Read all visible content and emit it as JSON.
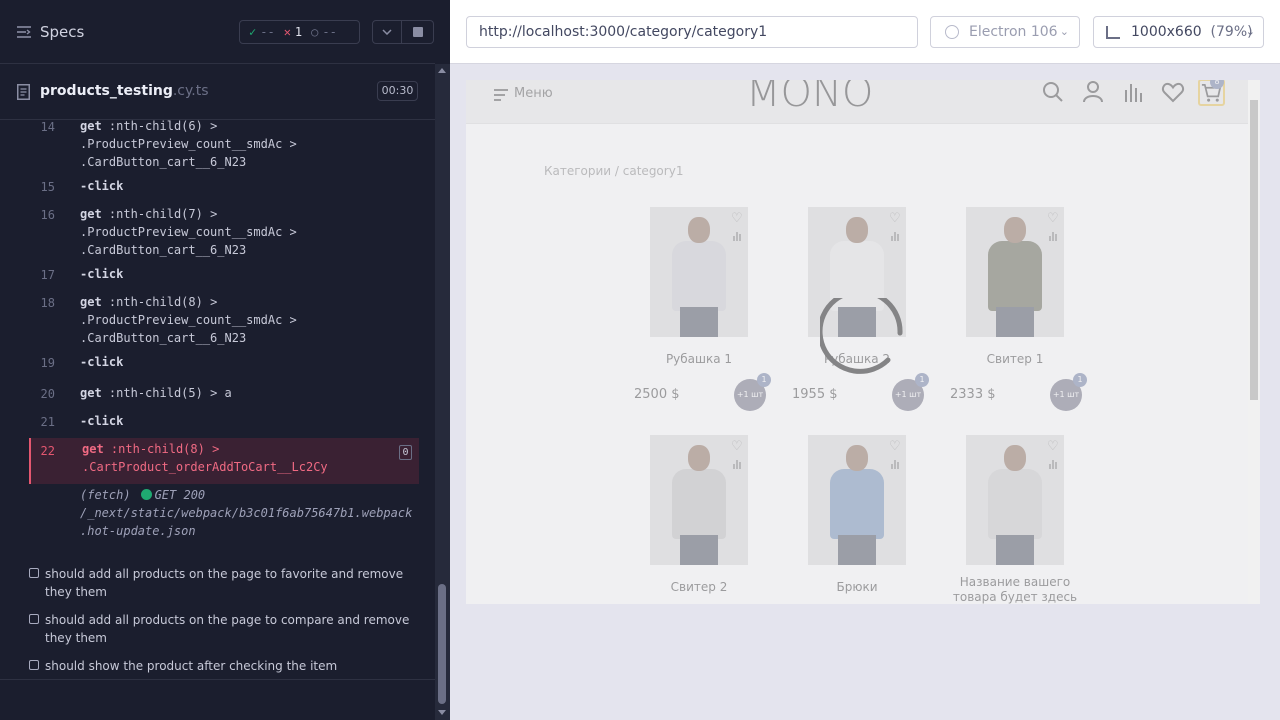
{
  "runner": {
    "specs_label": "Specs",
    "stats": {
      "passed": "--",
      "failed": "1",
      "pending": "--"
    },
    "spec_file": {
      "name": "products_testing",
      "ext": ".cy.ts",
      "duration": "00:30"
    },
    "commands": [
      {
        "num": "14",
        "cmd": "get",
        "arg": ":nth-child(6) >",
        "arg2": ".ProductPreview_count__smdAc >",
        "arg3": ".CardButton_cart__6_N23"
      },
      {
        "num": "15",
        "cmd": "-click"
      },
      {
        "num": "16",
        "cmd": "get",
        "arg": ":nth-child(7) >",
        "arg2": ".ProductPreview_count__smdAc >",
        "arg3": ".CardButton_cart__6_N23"
      },
      {
        "num": "17",
        "cmd": "-click"
      },
      {
        "num": "18",
        "cmd": "get",
        "arg": ":nth-child(8) >",
        "arg2": ".ProductPreview_count__smdAc >",
        "arg3": ".CardButton_cart__6_N23"
      },
      {
        "num": "19",
        "cmd": "-click"
      },
      {
        "num": "20",
        "cmd": "get",
        "arg": ":nth-child(5) > a"
      },
      {
        "num": "21",
        "cmd": "-click"
      },
      {
        "num": "22",
        "cmd": "get",
        "arg": ":nth-child(8) >",
        "arg2": ".CartProduct_orderAddToCart__Lc2Cy",
        "badge": "0"
      }
    ],
    "fetch_log": {
      "type": "(fetch)",
      "status": "GET 200",
      "path": "/_next/static/webpack/b3c01f6ab75647b1.webpack",
      "path2": ".hot-update.json"
    },
    "tests": [
      "should add all products on the page to favorite and remove they them",
      "should add all products on the page to compare and remove they them",
      "should show the product after checking the item"
    ]
  },
  "aut": {
    "url": "http://localhost:3000/category/category1",
    "browser": "Electron 106",
    "viewport": "1000x660",
    "scale": "(79%)"
  },
  "site": {
    "menu_label": "Меню",
    "logo": "MONO",
    "cart_count": "8",
    "breadcrumb": "Категории / category1",
    "products": [
      {
        "name": "Рубашка 1",
        "price": "2500 $",
        "add_label": "+1 шт",
        "count": "1",
        "shirt": "#c9cbd0"
      },
      {
        "name": "Рубашка 2",
        "price": "1955 $",
        "add_label": "+1 шт",
        "count": "1",
        "shirt": "#e6e6e6"
      },
      {
        "name": "Свитер 1",
        "price": "2333 $",
        "add_label": "+1 шт",
        "count": "1",
        "shirt": "#5c5e4a"
      },
      {
        "name": "Свитер 2",
        "shirt": "#bdbdbd"
      },
      {
        "name": "Брюки",
        "shirt": "#6a8bb3"
      },
      {
        "name": "Название вашего товара будет здесь",
        "shirt": "#c7c7c7"
      }
    ]
  }
}
